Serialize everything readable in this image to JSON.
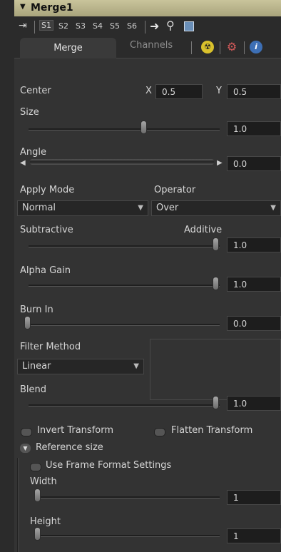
{
  "header": {
    "title": "Merge1"
  },
  "toolbar": {
    "slots": [
      "S1",
      "S2",
      "S3",
      "S4",
      "S5",
      "S6"
    ],
    "active_slot": "S1"
  },
  "tabs": {
    "merge": "Merge",
    "channels": "Channels"
  },
  "center": {
    "label": "Center",
    "x_label": "X",
    "x_value": "0.5",
    "y_label": "Y",
    "y_value": "0.5"
  },
  "size": {
    "label": "Size",
    "value": "1.0",
    "slider_fraction": 0.5
  },
  "angle": {
    "label": "Angle",
    "value": "0.0"
  },
  "apply_mode": {
    "label": "Apply Mode",
    "value": "Normal"
  },
  "operator": {
    "label": "Operator",
    "value": "Over"
  },
  "sub_add": {
    "left_label": "Subtractive",
    "right_label": "Additive",
    "value": "1.0",
    "slider_fraction": 1.0
  },
  "alpha_gain": {
    "label": "Alpha Gain",
    "value": "1.0",
    "slider_fraction": 1.0
  },
  "burn_in": {
    "label": "Burn In",
    "value": "0.0",
    "slider_fraction": 0.0
  },
  "filter_method": {
    "label": "Filter Method",
    "value": "Linear"
  },
  "blend": {
    "label": "Blend",
    "value": "1.0",
    "slider_fraction": 1.0
  },
  "checkboxes": {
    "invert_transform": "Invert Transform",
    "flatten_transform": "Flatten Transform",
    "use_frame_format": "Use Frame Format Settings"
  },
  "reference_size": {
    "label": "Reference size",
    "width_label": "Width",
    "width_value": "1",
    "height_label": "Height",
    "height_value": "1"
  },
  "colors": {
    "header_bg": "#b8b38b",
    "panel_bg": "#333333",
    "field_bg": "#1d1d1d"
  }
}
